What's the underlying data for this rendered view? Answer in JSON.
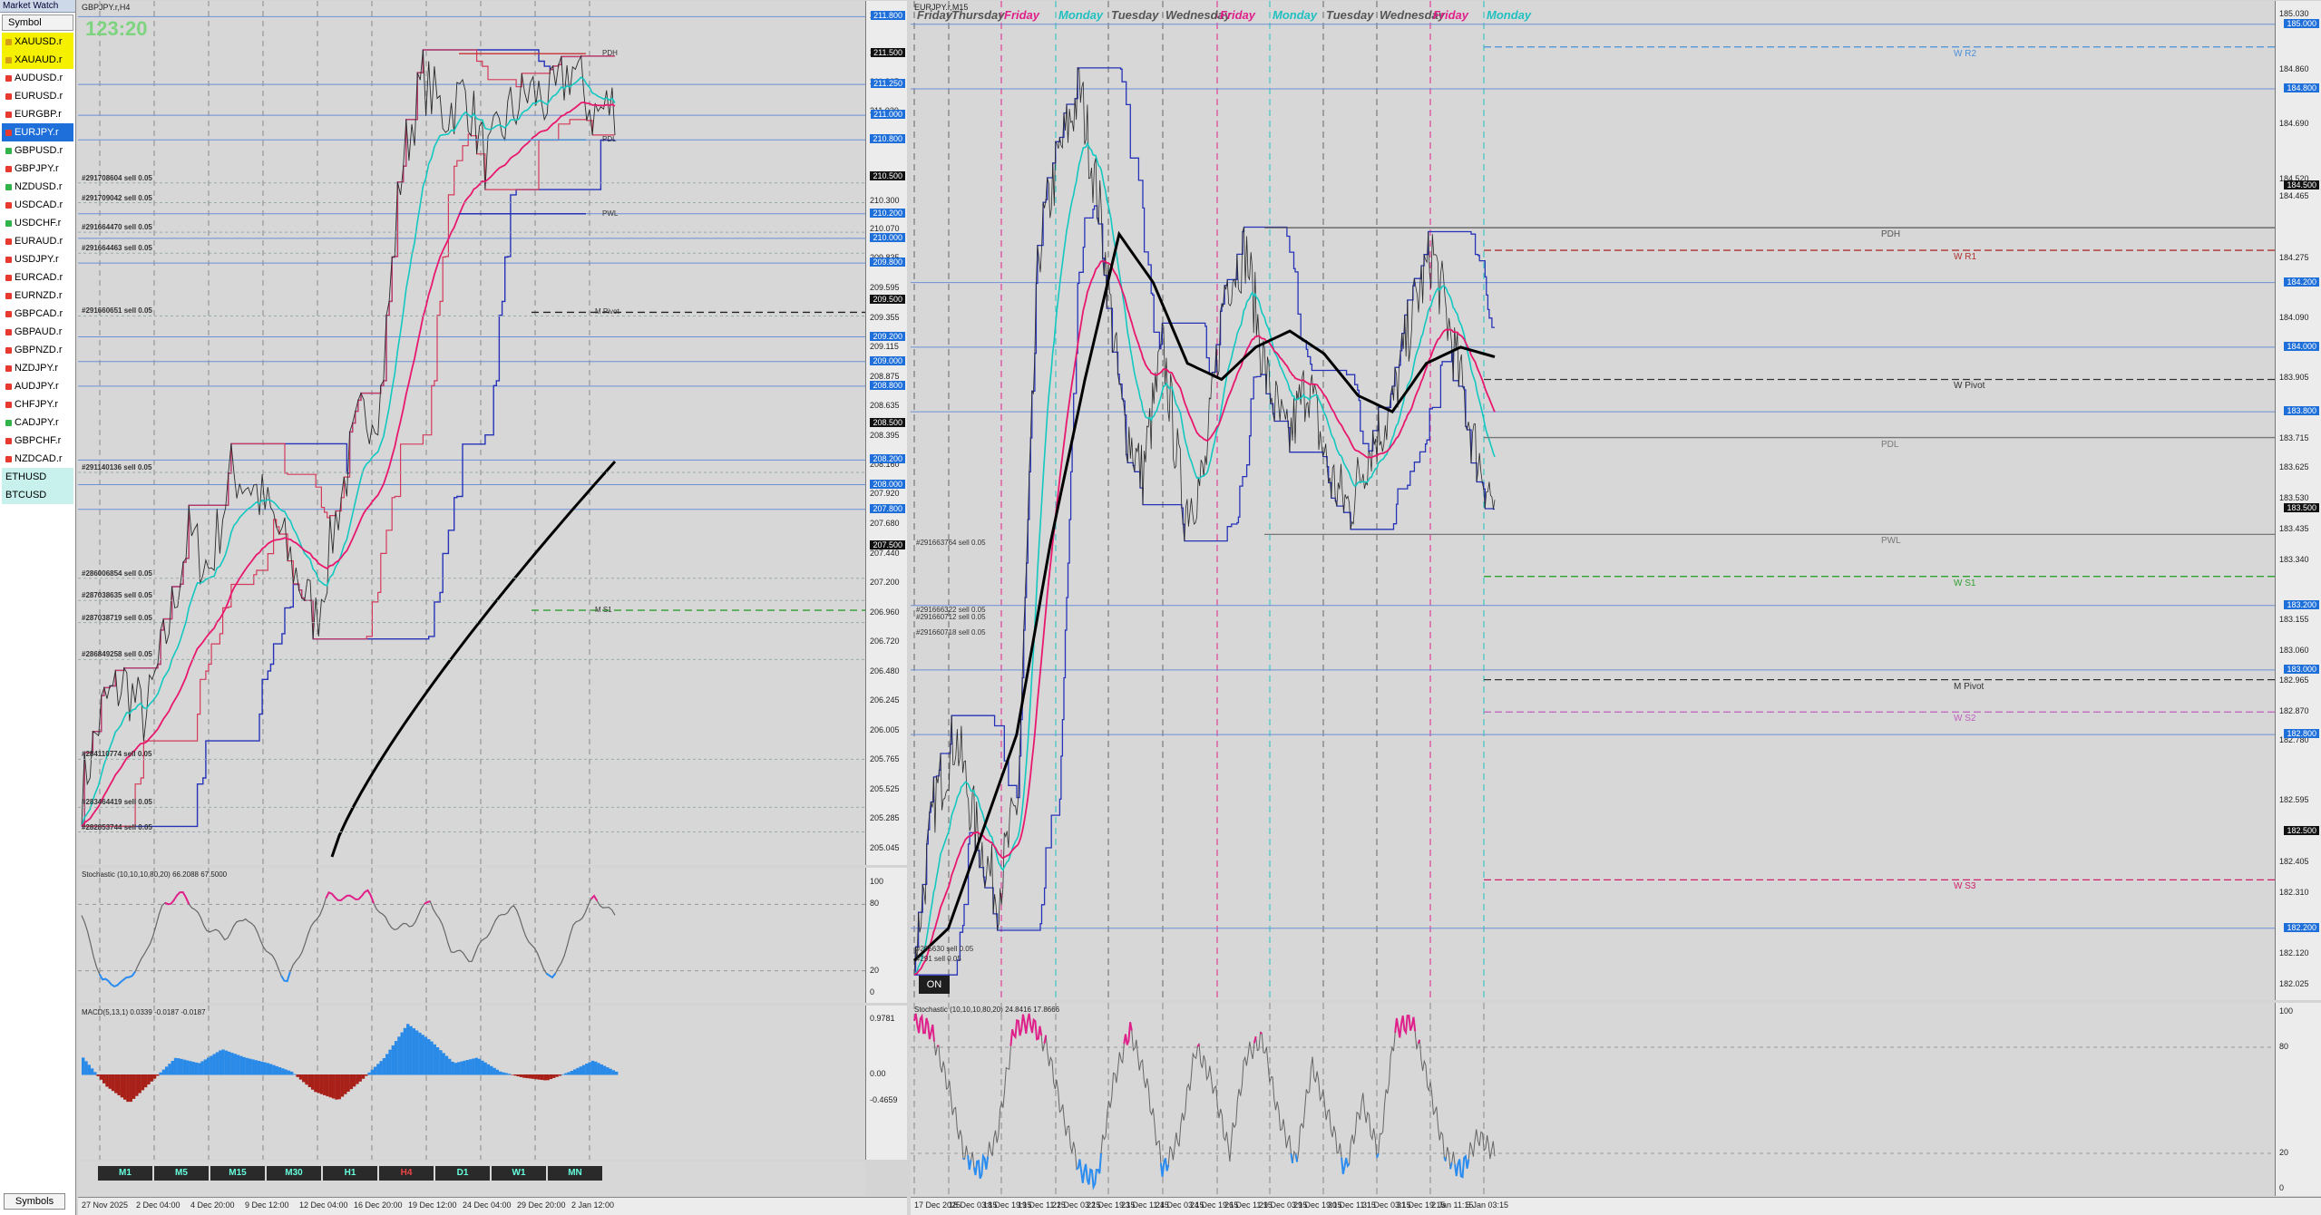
{
  "market_watch": {
    "title": "Market Watch",
    "header": "Symbol",
    "footer_tab": "Symbols",
    "symbols": [
      {
        "name": "XAUUSD.r",
        "bg": "#f5f000",
        "dot": "#d4a017"
      },
      {
        "name": "XAUAUD.r",
        "bg": "#f5f000",
        "dot": "#d4a017"
      },
      {
        "name": "AUDUSD.r",
        "bg": "#ffffff",
        "dot": "#e8392e"
      },
      {
        "name": "EURUSD.r",
        "bg": "#ffffff",
        "dot": "#e8392e"
      },
      {
        "name": "EURGBP.r",
        "bg": "#ffffff",
        "dot": "#e8392e"
      },
      {
        "name": "EURJPY.r",
        "bg": "#1e6fd9",
        "dot": "#e8392e"
      },
      {
        "name": "GBPUSD.r",
        "bg": "#ffffff",
        "dot": "#32b34a"
      },
      {
        "name": "GBPJPY.r",
        "bg": "#ffffff",
        "dot": "#e8392e"
      },
      {
        "name": "NZDUSD.r",
        "bg": "#ffffff",
        "dot": "#32b34a"
      },
      {
        "name": "USDCAD.r",
        "bg": "#ffffff",
        "dot": "#e8392e"
      },
      {
        "name": "USDCHF.r",
        "bg": "#ffffff",
        "dot": "#32b34a"
      },
      {
        "name": "EURAUD.r",
        "bg": "#ffffff",
        "dot": "#e8392e"
      },
      {
        "name": "USDJPY.r",
        "bg": "#ffffff",
        "dot": "#e8392e"
      },
      {
        "name": "EURCAD.r",
        "bg": "#ffffff",
        "dot": "#e8392e"
      },
      {
        "name": "EURNZD.r",
        "bg": "#ffffff",
        "dot": "#e8392e"
      },
      {
        "name": "GBPCAD.r",
        "bg": "#ffffff",
        "dot": "#e8392e"
      },
      {
        "name": "GBPAUD.r",
        "bg": "#ffffff",
        "dot": "#e8392e"
      },
      {
        "name": "GBPNZD.r",
        "bg": "#ffffff",
        "dot": "#e8392e"
      },
      {
        "name": "NZDJPY.r",
        "bg": "#ffffff",
        "dot": "#e8392e"
      },
      {
        "name": "AUDJPY.r",
        "bg": "#ffffff",
        "dot": "#e8392e"
      },
      {
        "name": "CHFJPY.r",
        "bg": "#ffffff",
        "dot": "#e8392e"
      },
      {
        "name": "CADJPY.r",
        "bg": "#ffffff",
        "dot": "#32b34a"
      },
      {
        "name": "GBPCHF.r",
        "bg": "#ffffff",
        "dot": "#e8392e"
      },
      {
        "name": "NZDCAD.r",
        "bg": "#ffffff",
        "dot": "#e8392e"
      },
      {
        "name": "ETHUSD",
        "bg": "#c8f0ec",
        "dot": ""
      },
      {
        "name": "BTCUSD",
        "bg": "#c8f0ec",
        "dot": ""
      }
    ]
  },
  "left_chart": {
    "title": "GBPJPY.r,H4",
    "countdown": "123:20",
    "price_labels": [
      "211.800",
      "211.500",
      "211.265",
      "211.030",
      "210.800",
      "210.500",
      "210.300",
      "210.070",
      "209.835",
      "209.595",
      "209.355",
      "209.115",
      "208.875",
      "208.635",
      "208.395",
      "208.160",
      "207.920",
      "207.680",
      "207.440",
      "207.200",
      "206.960",
      "206.720",
      "206.480",
      "206.245",
      "206.005",
      "205.765",
      "205.525",
      "205.285",
      "205.045"
    ],
    "badges": [
      {
        "value": "211.800",
        "color": "#1e6fd9"
      },
      {
        "value": "211.500",
        "color": "#111111"
      },
      {
        "value": "211.250",
        "color": "#1e6fd9"
      },
      {
        "value": "211.000",
        "color": "#1e6fd9"
      },
      {
        "value": "210.800",
        "color": "#1e6fd9"
      },
      {
        "value": "210.500",
        "color": "#111111"
      },
      {
        "value": "210.200",
        "color": "#1e6fd9"
      },
      {
        "value": "210.000",
        "color": "#1e6fd9"
      },
      {
        "value": "209.800",
        "color": "#1e6fd9"
      },
      {
        "value": "209.500",
        "color": "#111111"
      },
      {
        "value": "209.200",
        "color": "#1e6fd9"
      },
      {
        "value": "209.000",
        "color": "#1e6fd9"
      },
      {
        "value": "208.800",
        "color": "#1e6fd9"
      },
      {
        "value": "208.500",
        "color": "#111111"
      },
      {
        "value": "208.200",
        "color": "#1e6fd9"
      },
      {
        "value": "208.000",
        "color": "#1e6fd9"
      },
      {
        "value": "207.800",
        "color": "#1e6fd9"
      },
      {
        "value": "207.500",
        "color": "#111111"
      }
    ],
    "level_labels": [
      {
        "text": "PDH",
        "price": 211.5
      },
      {
        "text": "PDL",
        "price": 210.8
      },
      {
        "text": "PWL",
        "price": 210.2
      },
      {
        "text": "M Pivot",
        "price": 209.4
      },
      {
        "text": "M S1",
        "price": 206.98
      }
    ],
    "orders": [
      {
        "text": "#291708604 sell 0.05",
        "price": 210.45
      },
      {
        "text": "#291709042 sell 0.05",
        "price": 210.29
      },
      {
        "text": "#291664470 sell 0.05",
        "price": 210.05
      },
      {
        "text": "#291664463 sell 0.05",
        "price": 209.88
      },
      {
        "text": "#291660651 sell 0.05",
        "price": 209.37
      },
      {
        "text": "#291140136 sell 0.05",
        "price": 208.1
      },
      {
        "text": "#286006854 sell 0.05",
        "price": 207.24
      },
      {
        "text": "#287038635 sell 0.05",
        "price": 207.06
      },
      {
        "text": "#287038719 sell 0.05",
        "price": 206.88
      },
      {
        "text": "#286849258 sell 0.05",
        "price": 206.58
      },
      {
        "text": "#284110774 sell 0.05",
        "price": 205.77
      },
      {
        "text": "#283464419 sell 0.05",
        "price": 205.38
      },
      {
        "text": "#282853744 sell 0.05",
        "price": 205.18
      }
    ],
    "time_labels": [
      "27 Nov 2025",
      "2 Dec 04:00",
      "4 Dec 20:00",
      "9 Dec 12:00",
      "12 Dec 04:00",
      "16 Dec 20:00",
      "19 Dec 12:00",
      "24 Dec 04:00",
      "29 Dec 20:00",
      "2 Jan 12:00"
    ],
    "stochastic": {
      "label": "Stochastic (10,10,10,80,20) 66.2088 67.5000",
      "levels": [
        "100",
        "80",
        "20",
        "0"
      ]
    },
    "macd": {
      "label": "MACD(5,13,1) 0.0339 -0.0187 -0.0187",
      "levels": [
        "0.9781",
        "0.00",
        "-0.4659"
      ]
    },
    "timeframes": [
      "M1",
      "M5",
      "M15",
      "M30",
      "H1",
      "H4",
      "D1",
      "W1",
      "MN"
    ],
    "active_timeframe": "H4"
  },
  "right_chart": {
    "title": "EURJPY.r,M15",
    "day_labels": [
      {
        "text": "Friday",
        "color": "#555555"
      },
      {
        "text": "Thursday",
        "color": "#555555"
      },
      {
        "text": "Friday",
        "color": "#e0208a"
      },
      {
        "text": "Monday",
        "color": "#20c0c0"
      },
      {
        "text": "Tuesday",
        "color": "#555555"
      },
      {
        "text": "Wednesday",
        "color": "#555555"
      },
      {
        "text": "Friday",
        "color": "#e0208a"
      },
      {
        "text": "Monday",
        "color": "#20c0c0"
      },
      {
        "text": "Tuesday",
        "color": "#555555"
      },
      {
        "text": "Wednesday",
        "color": "#555555"
      },
      {
        "text": "Friday",
        "color": "#e0208a"
      },
      {
        "text": "Monday",
        "color": "#20c0c0"
      }
    ],
    "price_labels": [
      "185.030",
      "184.860",
      "184.690",
      "184.520",
      "184.465",
      "184.275",
      "184.090",
      "183.905",
      "183.715",
      "183.625",
      "183.530",
      "183.435",
      "183.340",
      "183.155",
      "183.060",
      "182.965",
      "182.870",
      "182.780",
      "182.595",
      "182.405",
      "182.310",
      "182.120",
      "182.025"
    ],
    "badges": [
      {
        "value": "185.000",
        "color": "#1e6fd9"
      },
      {
        "value": "184.800",
        "color": "#1e6fd9"
      },
      {
        "value": "184.500",
        "color": "#111111"
      },
      {
        "value": "184.200",
        "color": "#1e6fd9"
      },
      {
        "value": "184.000",
        "color": "#1e6fd9"
      },
      {
        "value": "183.800",
        "color": "#1e6fd9"
      },
      {
        "value": "183.500",
        "color": "#111111"
      },
      {
        "value": "183.200",
        "color": "#1e6fd9"
      },
      {
        "value": "183.000",
        "color": "#1e6fd9"
      },
      {
        "value": "182.800",
        "color": "#1e6fd9"
      },
      {
        "value": "182.500",
        "color": "#111111"
      },
      {
        "value": "182.200",
        "color": "#1e6fd9"
      }
    ],
    "level_labels": [
      {
        "text": "W R2",
        "price": 184.93,
        "color": "#4a90d9"
      },
      {
        "text": "PDH",
        "price": 184.37,
        "color": "#555555"
      },
      {
        "text": "W R1",
        "price": 184.3,
        "color": "#b03030"
      },
      {
        "text": "W Pivot",
        "price": 183.9,
        "color": "#333333"
      },
      {
        "text": "PDL",
        "price": 183.72,
        "color": "#777777"
      },
      {
        "text": "PWL",
        "price": 183.42,
        "color": "#777777"
      },
      {
        "text": "W S1",
        "price": 183.29,
        "color": "#30a030"
      },
      {
        "text": "M Pivot",
        "price": 182.97,
        "color": "#333333"
      },
      {
        "text": "W S2",
        "price": 182.87,
        "color": "#c060c0"
      },
      {
        "text": "W S3",
        "price": 182.35,
        "color": "#d0206a"
      }
    ],
    "orders": [
      {
        "text": "#291663764 sell 0.05",
        "price": 183.38
      },
      {
        "text": "#291666322 sell 0.05",
        "price": 183.17
      },
      {
        "text": "#291660712 sell 0.05",
        "price": 183.15
      },
      {
        "text": "#291660718 sell 0.05",
        "price": 183.1
      },
      {
        "text": "#295630 sell 0.05",
        "price": 182.12
      },
      {
        "text": "#291 sell 0.05",
        "price": 182.09
      }
    ],
    "time_labels": [
      "17 Dec 2025",
      "18 Dec 03:15",
      "18 Dec 19:15",
      "19 Dec 11:15",
      "22 Dec 03:15",
      "22 Dec 19:15",
      "23 Dec 11:15",
      "24 Dec 03:15",
      "24 Dec 19:15",
      "26 Dec 11:15",
      "29 Dec 03:15",
      "29 Dec 19:15",
      "30 Dec 11:15",
      "31 Dec 03:15",
      "31 Dec 19:15",
      "2 Jan 11:15",
      "5 Jan 03:15"
    ],
    "stochastic": {
      "label": "Stochastic (10,10,10,80,20) 24.8416 17.8666",
      "levels": [
        "100",
        "80",
        "20",
        "0"
      ]
    },
    "on_button": "ON"
  }
}
